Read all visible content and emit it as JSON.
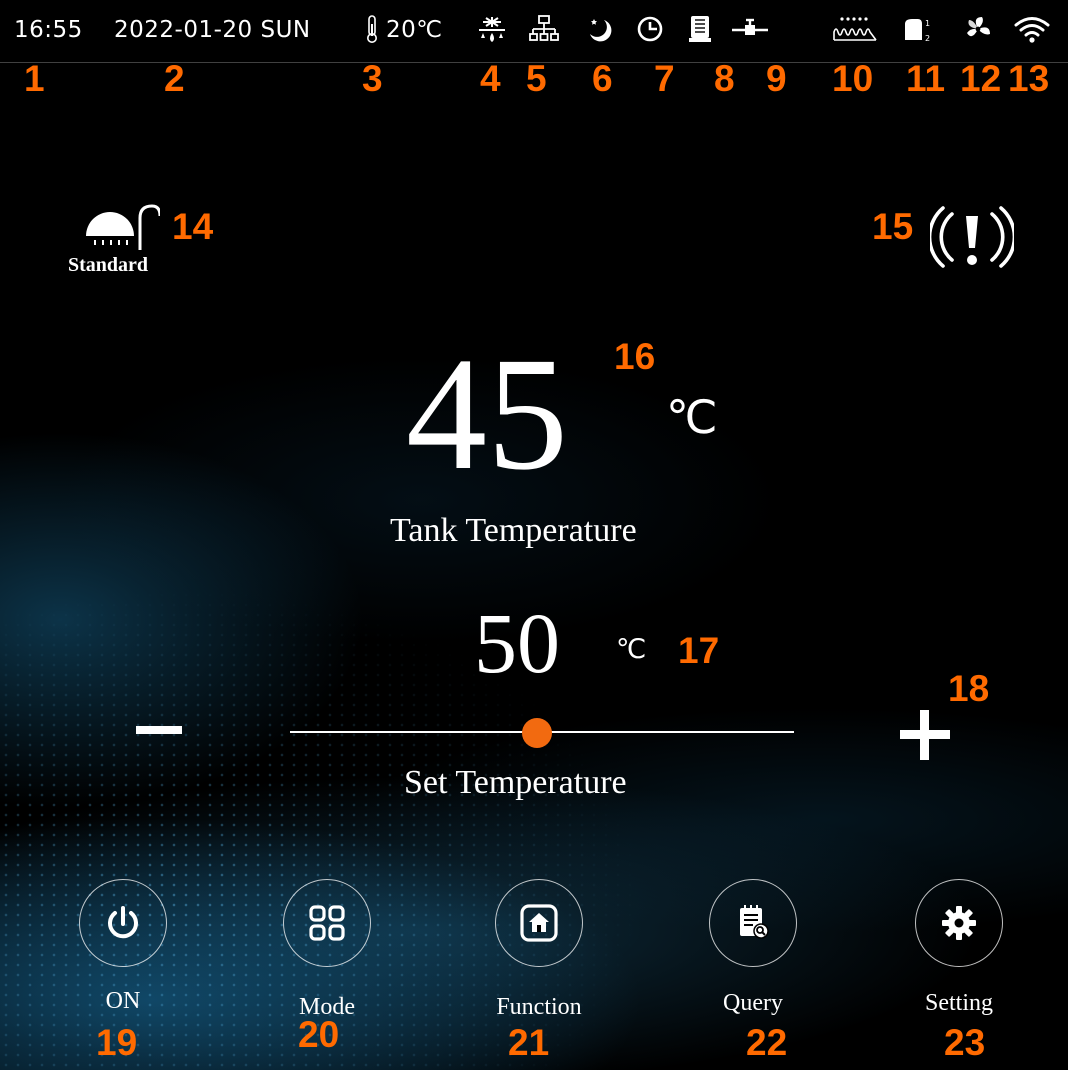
{
  "status_bar": {
    "time": "16:55",
    "date": "2022-01-20 SUN",
    "outdoor_temp": "20℃",
    "icons": [
      "thermometer-icon",
      "defrost-icon",
      "network-icon",
      "night-mode-icon",
      "timer-icon",
      "electric-heater-icon",
      "valve-icon",
      "heater-coil-icon",
      "compressor-icon",
      "fan-icon",
      "wifi-icon"
    ]
  },
  "mode": {
    "label": "Standard",
    "icon": "shower-icon"
  },
  "alarm": {
    "icon": "alarm-icon"
  },
  "tank": {
    "value": "45",
    "unit": "℃",
    "label": "Tank Temperature"
  },
  "set": {
    "value": "50",
    "unit": "℃",
    "label": "Set Temperature",
    "minus": "−",
    "plus": "+",
    "slider_fraction": 0.49
  },
  "bottom": [
    {
      "label": "ON",
      "icon": "power-icon"
    },
    {
      "label": "Mode",
      "icon": "grid-icon"
    },
    {
      "label": "Function",
      "icon": "home-icon"
    },
    {
      "label": "Query",
      "icon": "query-icon"
    },
    {
      "label": "Setting",
      "icon": "gear-icon"
    }
  ],
  "callouts": [
    "1",
    "2",
    "3",
    "4",
    "5",
    "6",
    "7",
    "8",
    "9",
    "10",
    "11",
    "12",
    "13",
    "14",
    "15",
    "16",
    "17",
    "18",
    "19",
    "20",
    "21",
    "22",
    "23"
  ],
  "colors": {
    "accent": "#ff6a00",
    "background": "#000000",
    "text": "#ffffff"
  }
}
